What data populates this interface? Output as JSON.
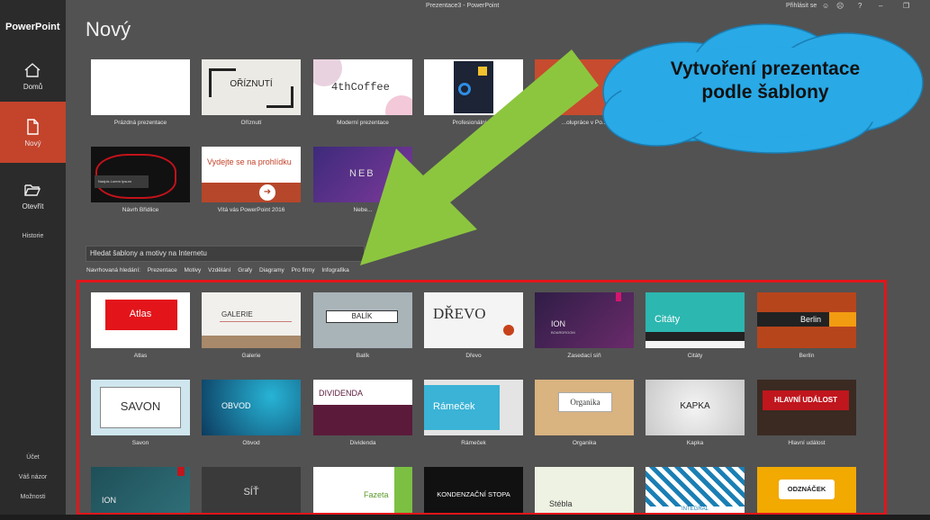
{
  "app": {
    "name": "PowerPoint",
    "window_title": "Prezentace3 - PowerPoint",
    "signin": "Přihlásit se"
  },
  "sidebar": {
    "items": [
      {
        "label": "Domů",
        "icon": "home-icon"
      },
      {
        "label": "Nový",
        "icon": "new-file-icon"
      },
      {
        "label": "Otevřít",
        "icon": "folder-open-icon"
      }
    ],
    "history": "Historie",
    "bottom": [
      "Účet",
      "Váš názor",
      "Možnosti"
    ]
  },
  "page": {
    "title": "Nový"
  },
  "featured": [
    {
      "caption": "Prázdná prezentace"
    },
    {
      "caption": "Oříznutí",
      "text": "OŘÍZNUTÍ"
    },
    {
      "caption": "Moderní prezentace",
      "text": "4thCoffee"
    },
    {
      "caption": "Profesionální t..."
    },
    {
      "caption": "...olupráce v Po..."
    },
    {
      "caption": "Návrh Břidlice",
      "text": "Nadpis Lorem Ipsum"
    },
    {
      "caption": "Vítá vás PowerPoint 2016",
      "text": "Vydejte se na prohlídku"
    },
    {
      "caption": "Nebe...",
      "text": "NEB"
    }
  ],
  "search": {
    "placeholder": "Hledat šablony a motivy na Internetu"
  },
  "suggested": {
    "label": "Navrhovaná hledání:",
    "items": [
      "Prezentace",
      "Motivy",
      "Vzdělání",
      "Grafy",
      "Diagramy",
      "Pro firmy",
      "Infografika"
    ]
  },
  "themes": [
    {
      "caption": "Atlas",
      "text": "Atlas"
    },
    {
      "caption": "Galerie",
      "text": "GALERIE"
    },
    {
      "caption": "Balík",
      "text": "BALÍK"
    },
    {
      "caption": "Dřevo",
      "text": "DŘEVO"
    },
    {
      "caption": "Zasedací síň",
      "text": "ION",
      "sub": "BOARDROOM"
    },
    {
      "caption": "Citáty",
      "text": "Citáty"
    },
    {
      "caption": "Berlín",
      "text": "Berlin"
    },
    {
      "caption": "Savon",
      "text": "SAVON"
    },
    {
      "caption": "Obvod",
      "text": "OBVOD"
    },
    {
      "caption": "Dividenda",
      "text": "DIVIDENDA"
    },
    {
      "caption": "Rámeček",
      "text": "Rámeček"
    },
    {
      "caption": "Organika",
      "text": "Organika"
    },
    {
      "caption": "Kapka",
      "text": "KAPKA"
    },
    {
      "caption": "Hlavní událost",
      "text": "HLAVNÍ UDÁLOST"
    },
    {
      "text": "ION"
    },
    {
      "text": "SÍŤ"
    },
    {
      "text": "Fazeta"
    },
    {
      "text": "KONDENZAČNÍ STOPA"
    },
    {
      "text": "Stébla"
    },
    {
      "text": "INTEGRÁL"
    },
    {
      "text": "ODZNÁČEK"
    }
  ],
  "callout": {
    "line1": "Vytvoření prezentace",
    "line2": "podle šablony",
    "color": "#29a9e6"
  },
  "colors": {
    "accent": "#c4432b",
    "frame": "#e3151a",
    "arrow": "#8cc63f"
  }
}
